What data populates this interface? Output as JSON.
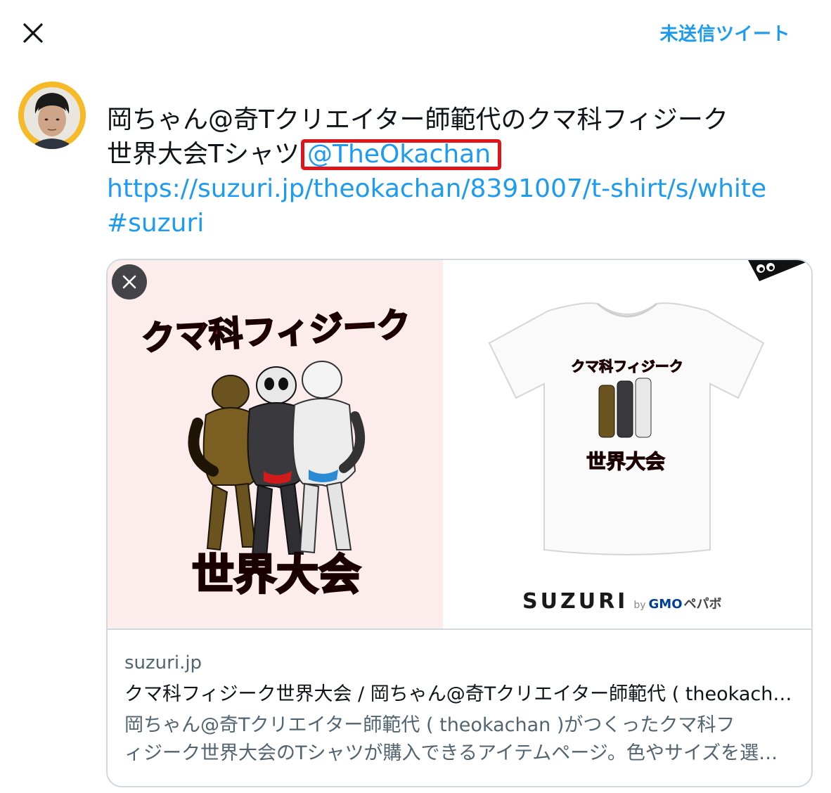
{
  "header": {
    "close_icon": "close-icon",
    "drafts_label": "未送信ツイート"
  },
  "tweet": {
    "line1": "岡ちゃん@奇Tクリエイター師範代のクマ科フィジーク",
    "line2_prefix": "世界大会Tシャツ",
    "mention": "@TheOkachan",
    "url": "https://suzuri.jp/theokachan/8391007/t-shirt/s/white",
    "hashtag": "#suzuri"
  },
  "card": {
    "art_top_text": "クマ科フィジーク",
    "art_bottom_text": "世界大会",
    "shirt_top_text": "クマ科フィジーク",
    "shirt_bottom_text": "世界大会",
    "brand_main": "SUZURI",
    "brand_by": "by",
    "brand_gmo": "GMO",
    "brand_pepabo": "ペパボ",
    "domain": "suzuri.jp",
    "title": "クマ科フィジーク世界大会 / 岡ちゃん@奇Tクリエイター師範代 ( theokachan )",
    "desc_line1": "岡ちゃん@奇Tクリエイター師範代 ( theokachan )がつくったクマ科フ",
    "desc_line2": "ィジーク世界大会のTシャツが購入できるアイテムページ。色やサイズを選んで購入できます。"
  },
  "colors": {
    "accent": "#1d9bf0",
    "highlight_box": "#e0151b",
    "art_background": "#fcecec",
    "avatar_ring": "#f6b928"
  }
}
